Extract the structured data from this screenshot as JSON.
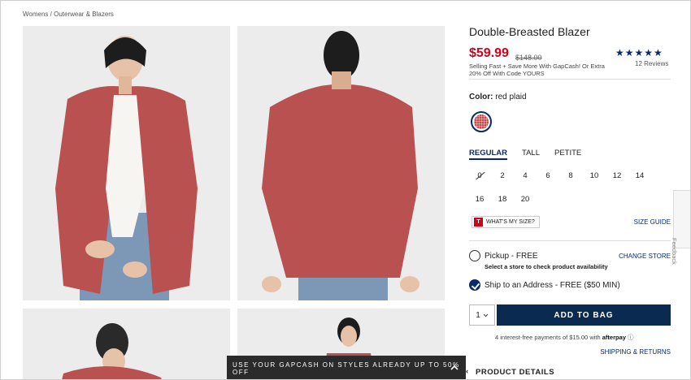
{
  "breadcrumb": {
    "items": [
      "Womens",
      "Outerwear & Blazers"
    ],
    "separator": "/"
  },
  "product": {
    "title": "Double-Breasted Blazer",
    "price": "$59.99",
    "old_price": "$148.00",
    "promo_note": "Selling Fast + Save More With GapCash! Or Extra 20% Off With Code YOURS",
    "rating_stars": "★★★★★",
    "rating": 4.5,
    "reviews": "12 Reviews"
  },
  "color": {
    "label": "Color:",
    "value": "red plaid"
  },
  "fits": [
    "REGULAR",
    "TALL",
    "PETITE"
  ],
  "sizes": [
    "0",
    "2",
    "4",
    "6",
    "8",
    "10",
    "12",
    "14",
    "16",
    "18",
    "20"
  ],
  "whats_my_size": {
    "badge": "T",
    "label": "WHAT'S MY SIZE?"
  },
  "size_guide": "SIZE GUIDE",
  "fulfillment": {
    "pickup_label": "Pickup - FREE",
    "pickup_sub": "Select a store to check product availability",
    "change_store": "CHANGE STORE",
    "ship_label": "Ship to an Address - FREE ($50 MIN)"
  },
  "cart": {
    "qty": "1",
    "add_to_bag": "ADD TO BAG",
    "afterpay_text": "4 interest-free payments of $15.00 with",
    "afterpay_brand": "afterpay",
    "shipping_returns": "SHIPPING & RETURNS",
    "product_details": "PRODUCT DETAILS"
  },
  "promo_banner": "USE YOUR GAPCASH ON STYLES ALREADY UP TO 50% OFF",
  "feedback": "Feedback",
  "colors": {
    "price_red": "#d0021b",
    "brand_navy": "#0b2a4f",
    "link_navy": "#0b2a6b",
    "blazer": "#b8514f"
  }
}
